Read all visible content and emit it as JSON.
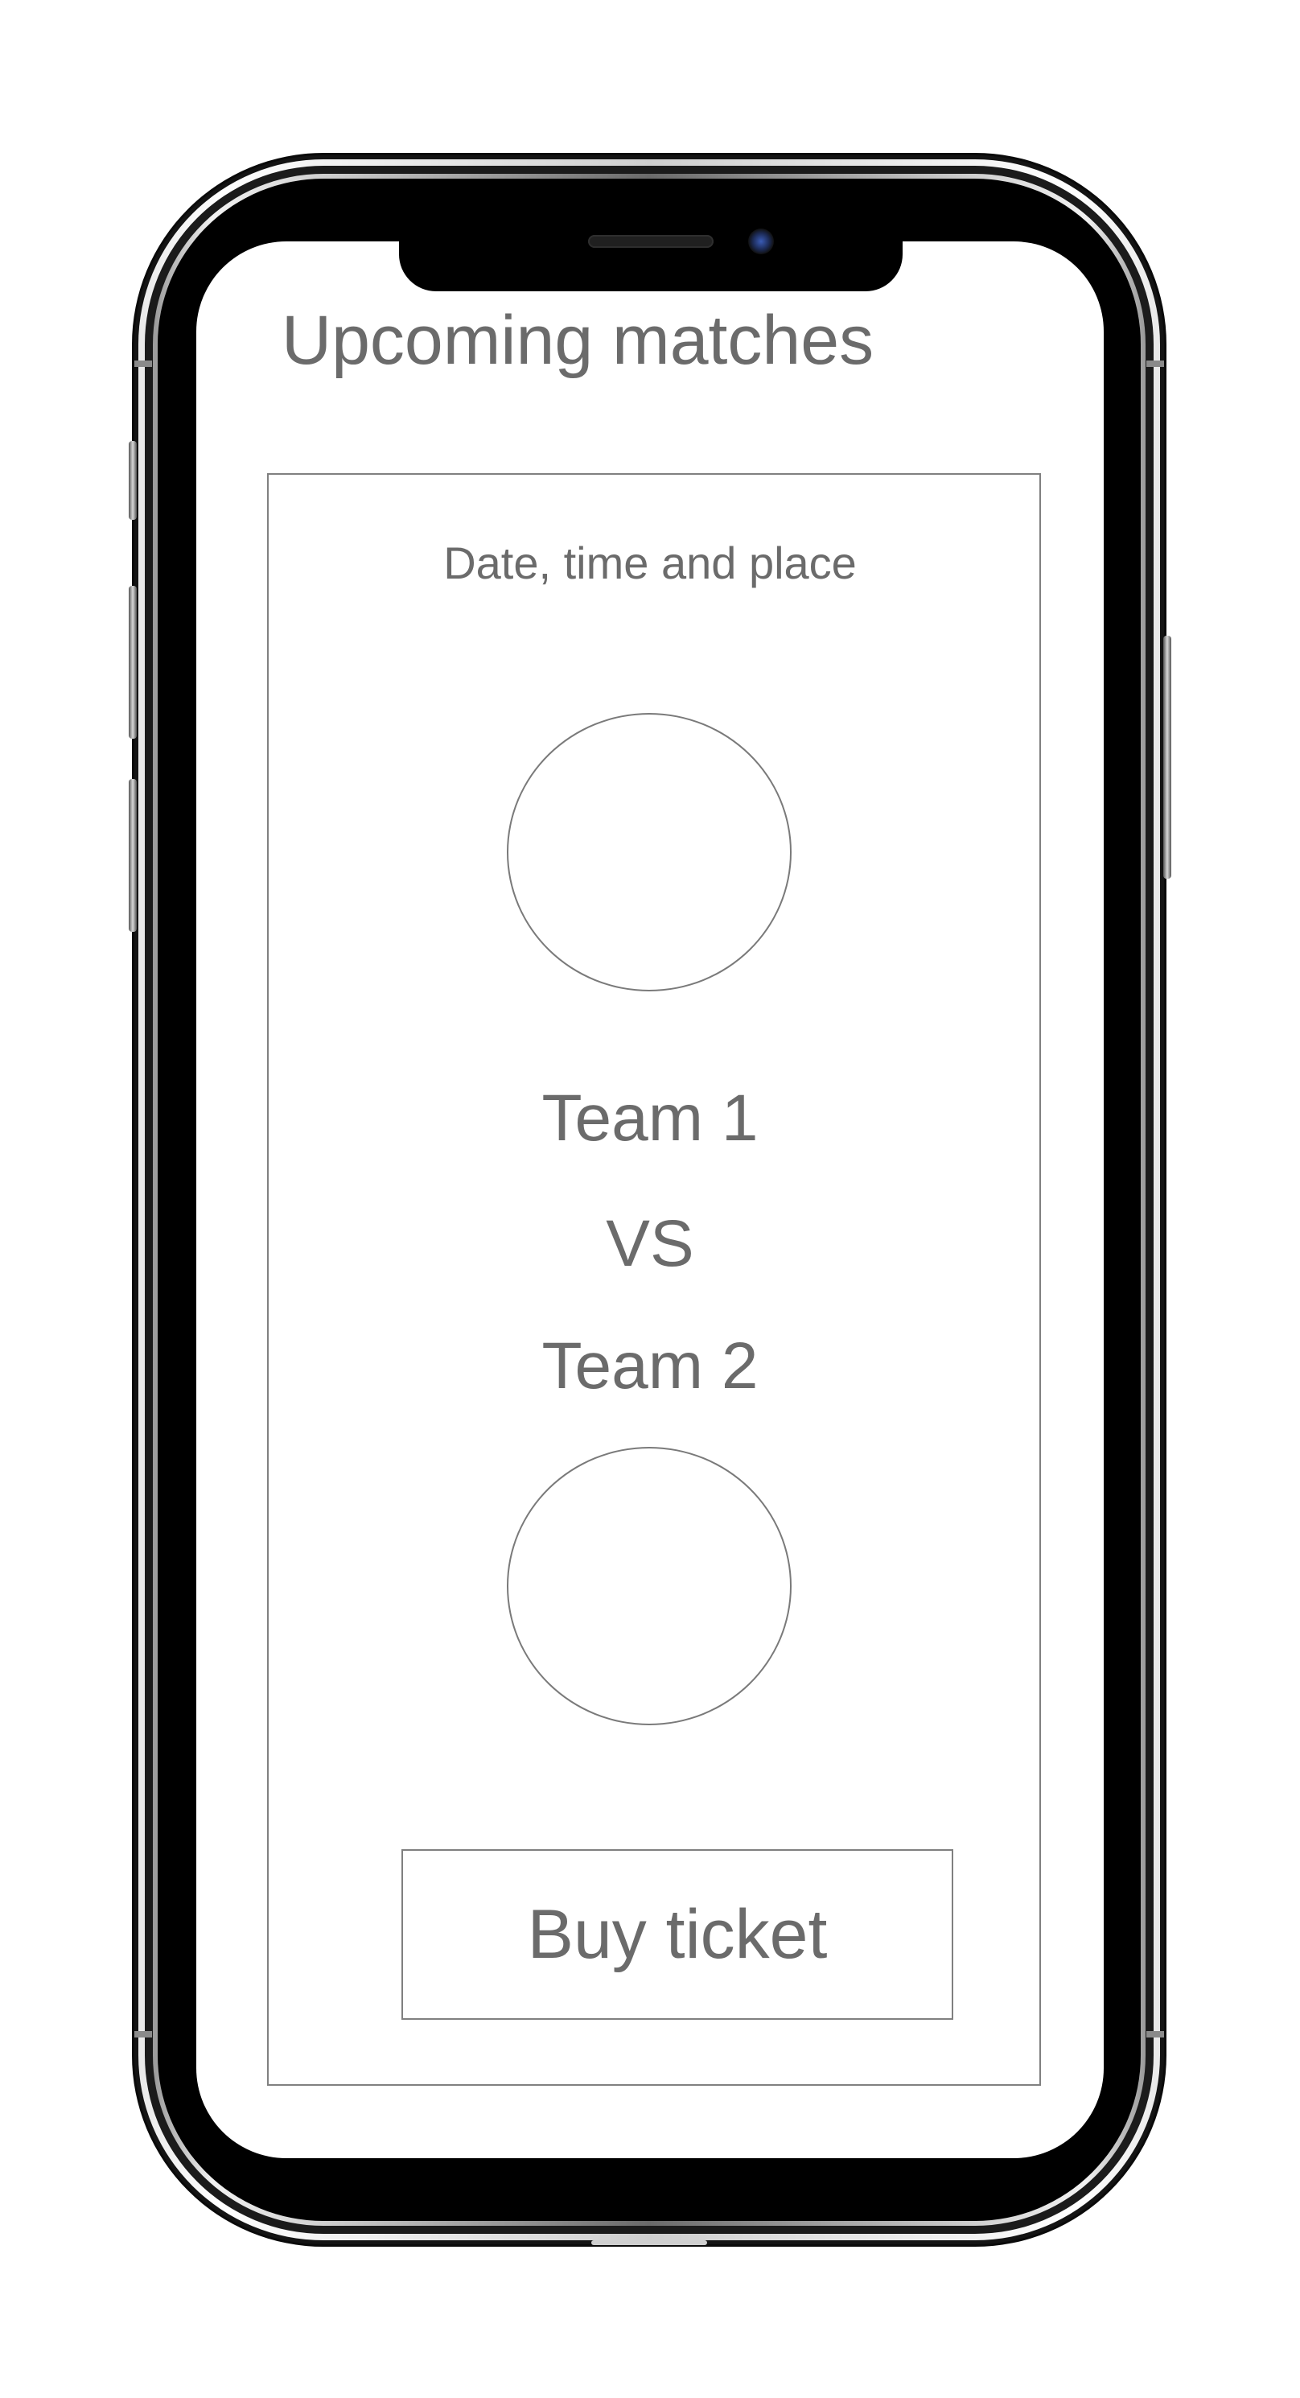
{
  "screen": {
    "title": "Upcoming matches"
  },
  "match": {
    "date_time_place": "Date, time and place",
    "team1": "Team 1",
    "versus": "VS",
    "team2": "Team 2",
    "buy_button_label": "Buy ticket"
  },
  "colors": {
    "text": "#6b6b6b",
    "border": "#808080",
    "background": "#ffffff",
    "device_frame": "#000000"
  }
}
